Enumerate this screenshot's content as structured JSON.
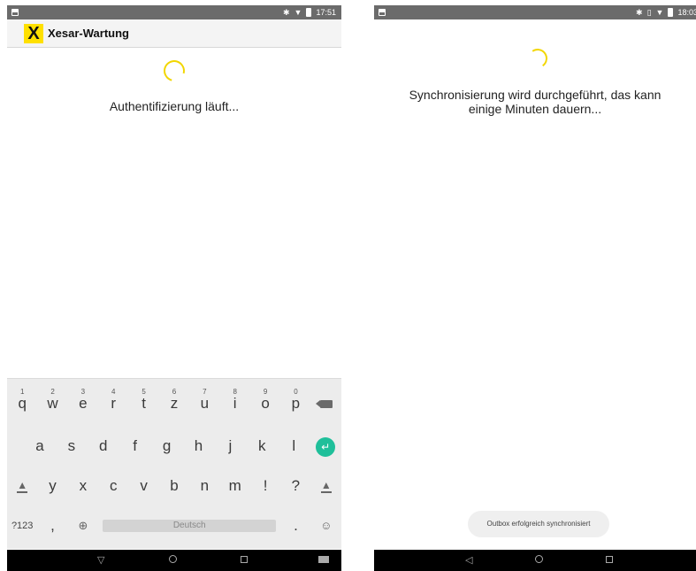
{
  "left": {
    "status": {
      "time": "17:51"
    },
    "app_bar": {
      "logo_text": "X",
      "title": "Xesar-Wartung"
    },
    "message": "Authentifizierung läuft...",
    "keyboard": {
      "row1": [
        {
          "char": "q",
          "hint": "1"
        },
        {
          "char": "w",
          "hint": "2"
        },
        {
          "char": "e",
          "hint": "3"
        },
        {
          "char": "r",
          "hint": "4"
        },
        {
          "char": "t",
          "hint": "5"
        },
        {
          "char": "z",
          "hint": "6"
        },
        {
          "char": "u",
          "hint": "7"
        },
        {
          "char": "i",
          "hint": "8"
        },
        {
          "char": "o",
          "hint": "9"
        },
        {
          "char": "p",
          "hint": "0"
        }
      ],
      "row2": [
        "a",
        "s",
        "d",
        "f",
        "g",
        "h",
        "j",
        "k",
        "l"
      ],
      "row3": [
        "y",
        "x",
        "c",
        "v",
        "b",
        "n",
        "m",
        "!",
        "?"
      ],
      "row4": {
        "symbols": "?123",
        "comma": ",",
        "space": "Deutsch",
        "period": "."
      }
    }
  },
  "right": {
    "status": {
      "time": "18:03"
    },
    "message": "Synchronisierung wird durchgeführt, das kann einige Minuten dauern...",
    "toast": "Outbox erfolgreich synchronisiert"
  },
  "colors": {
    "accent_yellow": "#f2d600",
    "enter_green": "#1fbf9a",
    "status_gray": "#6b6b6b"
  },
  "icons": [
    "notification-icon",
    "bluetooth-icon",
    "wifi-icon",
    "battery-icon",
    "vibrate-icon",
    "globe-icon",
    "emoji-icon",
    "backspace-icon",
    "enter-icon",
    "shift-icon",
    "nav-back-icon",
    "nav-home-icon",
    "nav-recents-icon",
    "keyboard-switch-icon"
  ]
}
